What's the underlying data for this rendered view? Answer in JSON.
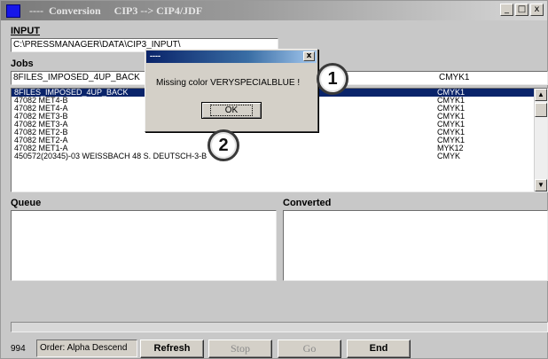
{
  "window": {
    "title": "----  Conversion     CIP3 --> CIP4/JDF",
    "controls": {
      "minimize": "_",
      "maximize": "□",
      "close": "x"
    }
  },
  "input": {
    "label": "INPUT",
    "path": "C:\\PRESSMANAGER\\DATA\\CIP3_INPUT\\"
  },
  "jobs": {
    "label": "Jobs",
    "current_name": "8FILES_IMPOSED_4UP_BACK",
    "current_profile": "CMYK1",
    "rows": [
      {
        "name": "8FILES_IMPOSED_4UP_BACK",
        "profile": "CMYK1",
        "selected": true
      },
      {
        "name": "47082 MET4-B",
        "profile": "CMYK1"
      },
      {
        "name": "47082 MET4-A",
        "profile": "CMYK1"
      },
      {
        "name": "47082 MET3-B",
        "profile": "CMYK1"
      },
      {
        "name": "47082 MET3-A",
        "profile": "CMYK1"
      },
      {
        "name": "47082 MET2-B",
        "profile": "CMYK1"
      },
      {
        "name": "47082 MET2-A",
        "profile": "CMYK1"
      },
      {
        "name": "47082 MET1-A",
        "profile": "MYK12"
      },
      {
        "name": "450572(20345)-03 WEISSBACH 48 S. DEUTSCH-3-B",
        "profile": "CMYK"
      }
    ],
    "scroll_up": "▲",
    "scroll_down": "▼"
  },
  "queue": {
    "label": "Queue"
  },
  "converted": {
    "label": "Converted"
  },
  "bottom": {
    "count": "994",
    "order": "Order: Alpha Descend",
    "refresh": "Refresh",
    "stop": "Stop",
    "go": "Go",
    "end": "End"
  },
  "dialog": {
    "title": "----",
    "close": "x",
    "message": "Missing color VERYSPECIALBLUE !",
    "ok": "OK"
  },
  "callouts": [
    "1",
    "2"
  ]
}
